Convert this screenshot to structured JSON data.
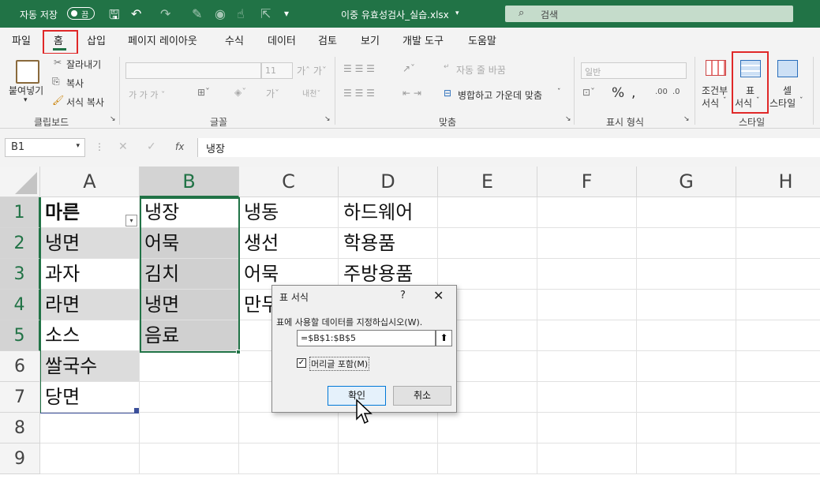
{
  "titlebar": {
    "autosave_label": "자동 저장",
    "toggle_state": "끔",
    "filename": "이중 유효성검사_실습.xlsx",
    "search_placeholder": "검색"
  },
  "tabs": [
    "파일",
    "홈",
    "삽입",
    "페이지 레이아웃",
    "수식",
    "데이터",
    "검토",
    "보기",
    "개발 도구",
    "도움말"
  ],
  "ribbon": {
    "clipboard": {
      "paste": "붙여넣기",
      "cut": "잘라내기",
      "copy": "복사",
      "format_painter": "서식 복사",
      "group": "클립보드"
    },
    "font": {
      "font_size": "11",
      "group": "글꼴"
    },
    "alignment": {
      "wrap_text": "자동 줄 바꿈",
      "merge_center": "병합하고 가운데 맞춤",
      "group": "맞춤"
    },
    "number": {
      "format": "일반",
      "group": "표시 형식"
    },
    "styles": {
      "conditional_l1": "조건부",
      "conditional_l2": "서식",
      "table_l1": "표",
      "table_l2": "서식",
      "cell_l1": "셀",
      "cell_l2": "스타일",
      "group": "스타일"
    }
  },
  "formula_bar": {
    "name_box": "B1",
    "content": "냉장"
  },
  "columns": [
    "A",
    "B",
    "C",
    "D",
    "E",
    "F",
    "G",
    "H"
  ],
  "rows": [
    [
      "마른",
      "냉장",
      "냉동",
      "하드웨어"
    ],
    [
      "냉면",
      "어묵",
      "생선",
      "학용품"
    ],
    [
      "과자",
      "김치",
      "어묵",
      "주방용품"
    ],
    [
      "라면",
      "냉면",
      "만두",
      ""
    ],
    [
      "소스",
      "음료",
      "",
      ""
    ],
    [
      "쌀국수",
      "",
      "",
      ""
    ],
    [
      "당면",
      "",
      "",
      ""
    ],
    [
      "",
      "",
      "",
      ""
    ],
    [
      "",
      "",
      "",
      ""
    ]
  ],
  "dialog": {
    "title": "표 서식",
    "help": "?",
    "prompt": "표에 사용할 데이터를 지정하십시오(W).",
    "range": "=$B$1:$B$5",
    "header_checkbox": "머리글 포함(M)",
    "header_checked": true,
    "ok": "확인",
    "cancel": "취소"
  }
}
